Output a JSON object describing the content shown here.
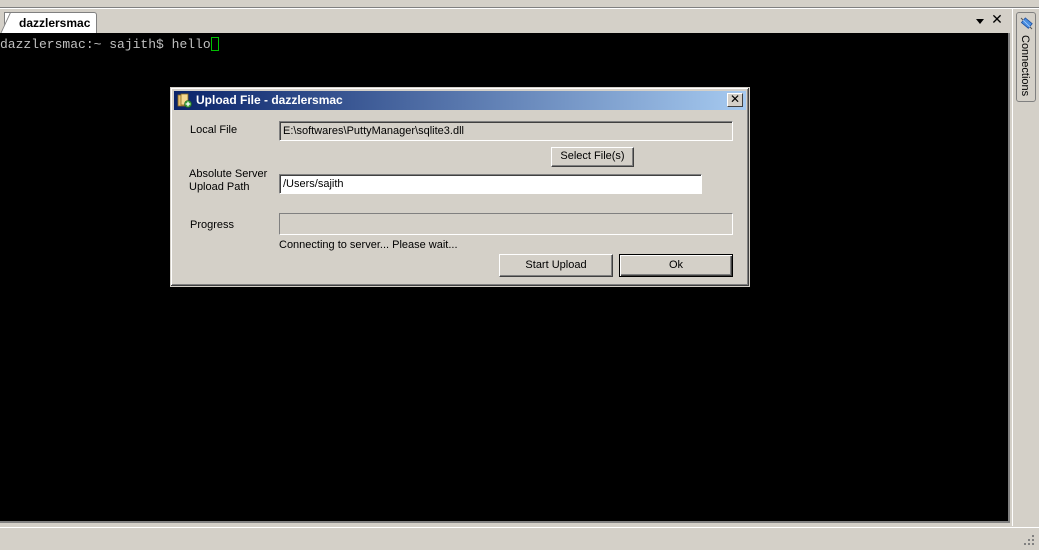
{
  "tabs": [
    {
      "label": "dazzlersmac",
      "active": true
    }
  ],
  "tab_controls": {
    "menu_icon": "dropdown-arrow",
    "close_label": "✕"
  },
  "terminal": {
    "prompt": "dazzlersmac:~ sajith$ ",
    "command": "hello"
  },
  "side_panel": {
    "tab_label": "Connections",
    "icon": "connections-icon"
  },
  "dialog": {
    "title": "Upload File - dazzlersmac",
    "close_label": "✕",
    "local_file_label": "Local File",
    "local_file_value": "E:\\softwares\\PuttyManager\\sqlite3.dll",
    "select_files_button": "Select File(s)",
    "server_path_label_line1": "Absolute Server",
    "server_path_label_line2": "Upload Path",
    "server_path_value": "/Users/sajith",
    "progress_label": "Progress",
    "progress_percent": 0,
    "status_text": "Connecting to server... Please wait...",
    "start_upload_button": "Start Upload",
    "ok_button": "Ok"
  }
}
